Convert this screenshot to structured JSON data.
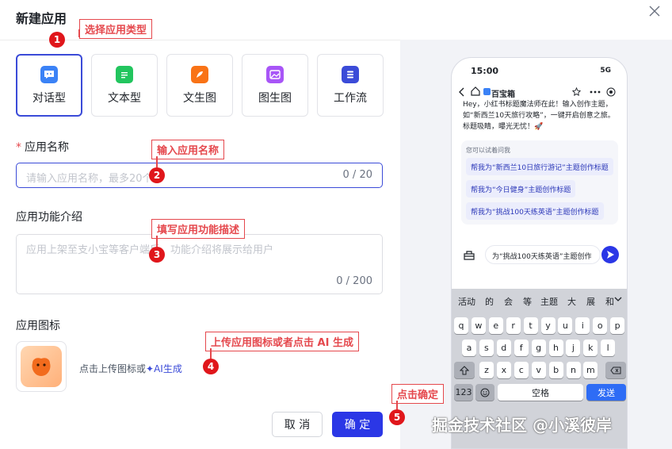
{
  "dialog": {
    "title": "新建应用"
  },
  "app_types": [
    {
      "label": "对话型",
      "icon": "chat-bubble-icon",
      "color": "#3b82f6"
    },
    {
      "label": "文本型",
      "icon": "document-icon",
      "color": "#22c55e"
    },
    {
      "label": "文生图",
      "icon": "feather-icon",
      "color": "#f97316"
    },
    {
      "label": "图生图",
      "icon": "image-icon",
      "color": "#a855f7"
    },
    {
      "label": "工作流",
      "icon": "workflow-icon",
      "color": "#3b4bd8"
    }
  ],
  "form": {
    "name_required_mark": "*",
    "name_label": "应用名称",
    "name_placeholder": "请输入应用名称，最多20个字",
    "name_count": "0 / 20",
    "desc_label": "应用功能介绍",
    "desc_placeholder": "应用上架至支小宝等客户端后，功能介绍将展示给用户",
    "desc_count": "0 / 200",
    "icon_label": "应用图标",
    "upload_text": "点击上传图标或",
    "ai_generate": "✦AI生成"
  },
  "footer": {
    "cancel": "取 消",
    "ok": "确 定"
  },
  "annotations": [
    {
      "num": "1",
      "text": "选择应用类型"
    },
    {
      "num": "2",
      "text": "输入应用名称"
    },
    {
      "num": "3",
      "text": "填写应用功能描述"
    },
    {
      "num": "4",
      "text": "上传应用图标或者点击 AI 生成"
    },
    {
      "num": "5",
      "text": "点击确定"
    }
  ],
  "phone": {
    "time": "15:00",
    "status_icons": "5G",
    "app_name": "百宝箱",
    "message": "Hey，小红书标题魔法师在此！输入创作主题，如“新西兰10天旅行攻略”，一键开启创意之旅。标题吸睛，曝光无忧！🚀",
    "suggest_hint": "您可以试着问我",
    "suggestions": [
      "帮我为“新西兰10日旅行游记”主题创作标题",
      "帮我为“今日健身”主题创作标题",
      "帮我为“挑战100天练英语”主题创作标题"
    ],
    "input_text": "为“挑战100天练英语”主题创作",
    "candidates": [
      "活动",
      "的",
      "会",
      "等",
      "主题",
      "大",
      "展",
      "和"
    ],
    "row1": [
      "q",
      "w",
      "e",
      "r",
      "t",
      "y",
      "u",
      "i",
      "o",
      "p"
    ],
    "row2": [
      "a",
      "s",
      "d",
      "f",
      "g",
      "h",
      "j",
      "k",
      "l"
    ],
    "row3": [
      "z",
      "x",
      "c",
      "v",
      "b",
      "n",
      "m"
    ],
    "key_123": "123",
    "key_space": "空格",
    "key_send": "发送"
  },
  "watermark": "掘金技术社区 @小溪彼岸"
}
